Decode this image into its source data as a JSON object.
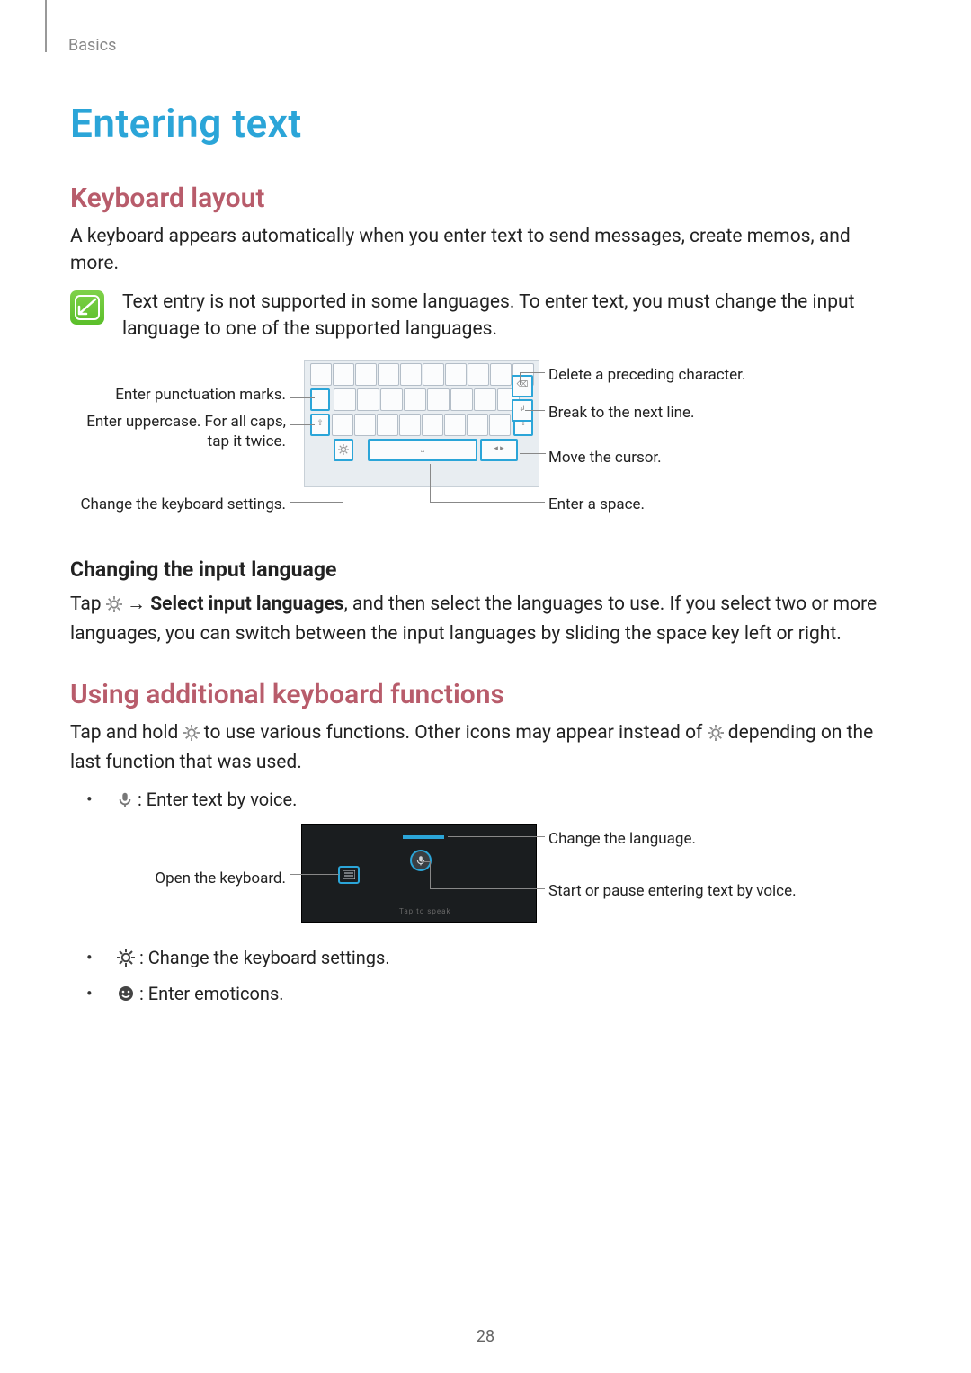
{
  "section_label": "Basics",
  "title": "Entering text",
  "sub1": "Keyboard layout",
  "p1": "A keyboard appears automatically when you enter text to send messages, create memos, and more.",
  "note": "Text entry is not supported in some languages. To enter text, you must change the input language to one of the supported languages.",
  "kbd_labels": {
    "punct": "Enter punctuation marks.",
    "upper": "Enter uppercase. For all caps, tap it twice.",
    "settings": "Change the keyboard settings.",
    "del": "Delete a preceding character.",
    "break": "Break to the next line.",
    "move": "Move the cursor.",
    "space": "Enter a space."
  },
  "sub1a": "Changing the input language",
  "p2a": "Tap ",
  "p2_bold": "Select input languages",
  "p2b": ", and then select the languages to use. If you select two or more languages, you can switch between the input languages by sliding the space key left or right.",
  "sub2": "Using additional keyboard functions",
  "p3a": "Tap and hold ",
  "p3b": " to use various functions. Other icons may appear instead of ",
  "p3c": " depending on the last function that was used.",
  "bullets": {
    "voice": " : Enter text by voice.",
    "settings": " : Change the keyboard settings.",
    "emoticons": " : Enter emoticons."
  },
  "voice_labels": {
    "open": "Open the keyboard.",
    "chlang": "Change the language.",
    "start": "Start or pause entering text by voice."
  },
  "voice_box_hint": "Tap to speak",
  "pagenum": "28",
  "arrow": "→"
}
